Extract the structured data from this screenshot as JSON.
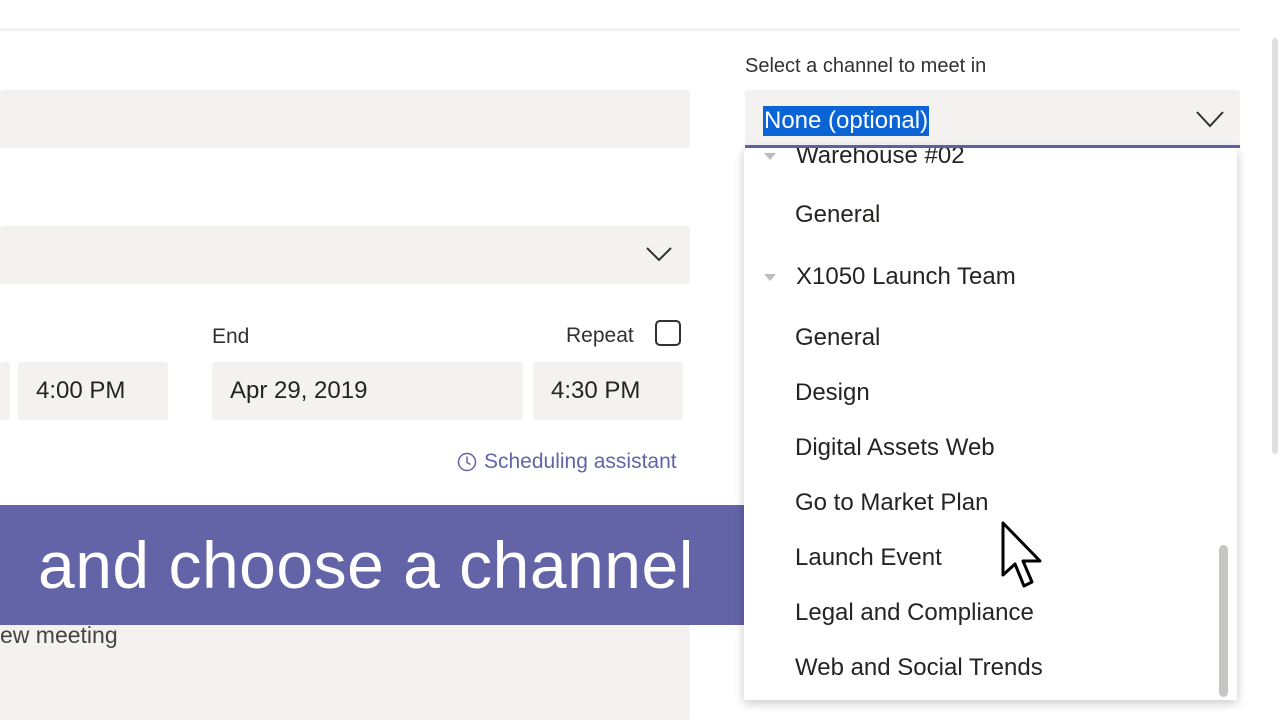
{
  "form": {
    "end_label": "End",
    "repeat_label": "Repeat",
    "start_time": "4:00 PM",
    "end_date": "Apr 29, 2019",
    "end_time": "4:30 PM",
    "scheduling_assistant": "Scheduling assistant",
    "details_partial": "ew meeting"
  },
  "caption": {
    "text": "and choose a channel",
    "color": "#6264a7"
  },
  "channel": {
    "label": "Select a channel to meet in",
    "selected": "None (optional)",
    "teams": [
      {
        "name": "Warehouse #02",
        "channels": [
          "General"
        ]
      },
      {
        "name": "X1050 Launch Team",
        "channels": [
          "General",
          "Design",
          "Digital Assets Web",
          "Go to Market Plan",
          "Launch Event",
          "Legal and Compliance",
          "Web and Social Trends"
        ]
      }
    ]
  },
  "icons": {
    "attendees": "chevron-down-icon",
    "select": "chevron-down-icon",
    "scheduling": "clock-icon",
    "team": "caret-down-icon",
    "pointer": "mouse-cursor-icon"
  },
  "colors": {
    "accent": "#6264a7",
    "selection": "#0a64d6",
    "field": "#f3f2f1"
  }
}
